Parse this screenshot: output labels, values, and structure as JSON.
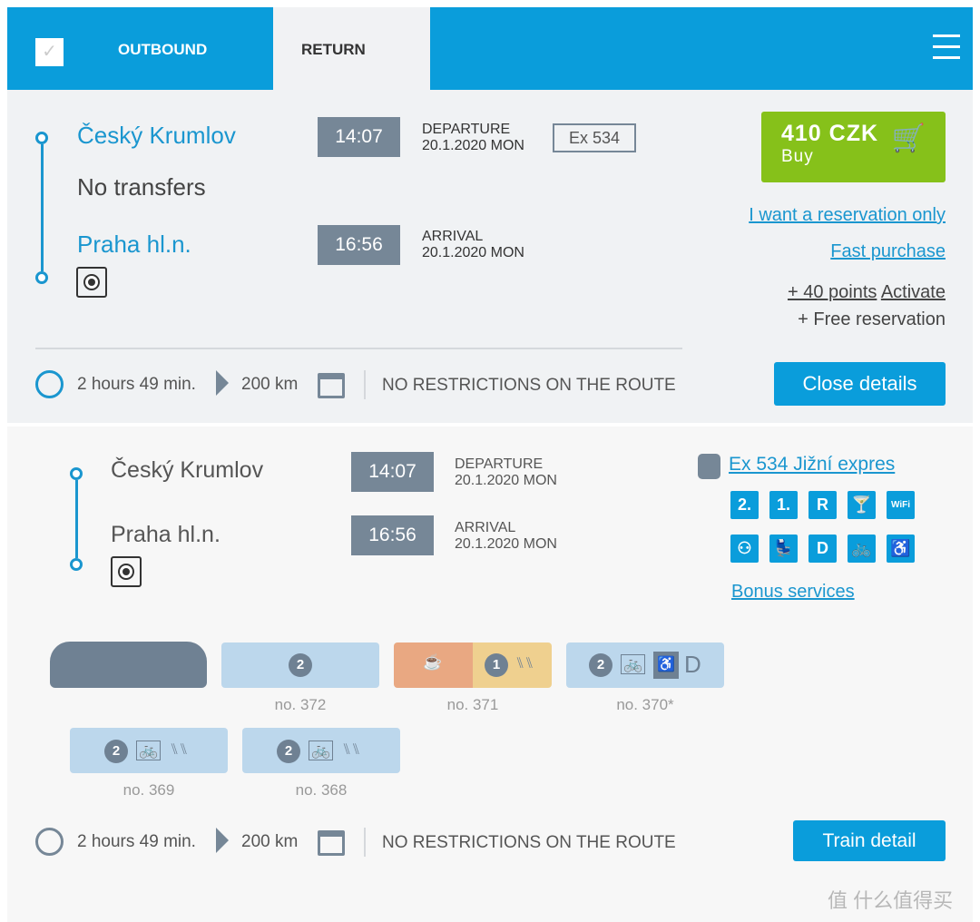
{
  "tabs": {
    "outbound": "OUTBOUND",
    "return": "RETURN"
  },
  "summary": {
    "from": "Český Krumlov",
    "transfers": "No transfers",
    "to": "Praha hl.n.",
    "dep_time": "14:07",
    "dep_label": "DEPARTURE",
    "dep_date": "20.1.2020 MON",
    "train": "Ex 534",
    "arr_time": "16:56",
    "arr_label": "ARRIVAL",
    "arr_date": "20.1.2020 MON",
    "price": "410 CZK",
    "buy": "Buy",
    "reservation_only": "I want a reservation only",
    "fast_purchase": "Fast purchase",
    "points": "+ 40 points",
    "activate": "Activate",
    "free_reservation": "+ Free reservation",
    "duration": "2 hours 49 min.",
    "distance": "200 km",
    "restrictions": "NO RESTRICTIONS ON THE ROUTE",
    "close_details": "Close details"
  },
  "detail": {
    "from": "Český Krumlov",
    "to": "Praha hl.n.",
    "dep_time": "14:07",
    "dep_label": "DEPARTURE",
    "dep_date": "20.1.2020 MON",
    "arr_time": "16:56",
    "arr_label": "ARRIVAL",
    "arr_date": "20.1.2020 MON",
    "train_name": "Ex 534 Jižní expres",
    "services": [
      "2.",
      "1.",
      "R",
      "🍸",
      "WiFi",
      "⚇",
      "💺",
      "D",
      "🚲",
      "♿"
    ],
    "bonus": "Bonus services",
    "cars": [
      {
        "no": "no. 372",
        "cls": "2"
      },
      {
        "no": "no. 371",
        "cls": "1"
      },
      {
        "no": "no. 370*",
        "cls": "2",
        "extra": "D"
      },
      {
        "no": "no. 369",
        "cls": "2"
      },
      {
        "no": "no. 368",
        "cls": "2"
      }
    ],
    "duration": "2 hours 49 min.",
    "distance": "200 km",
    "restrictions": "NO RESTRICTIONS ON THE ROUTE",
    "train_detail": "Train detail"
  },
  "watermark": "值 什么值得买",
  "colors": {
    "accent": "#0a9ddb",
    "buy": "#86c11a",
    "time_bg": "#768797"
  }
}
